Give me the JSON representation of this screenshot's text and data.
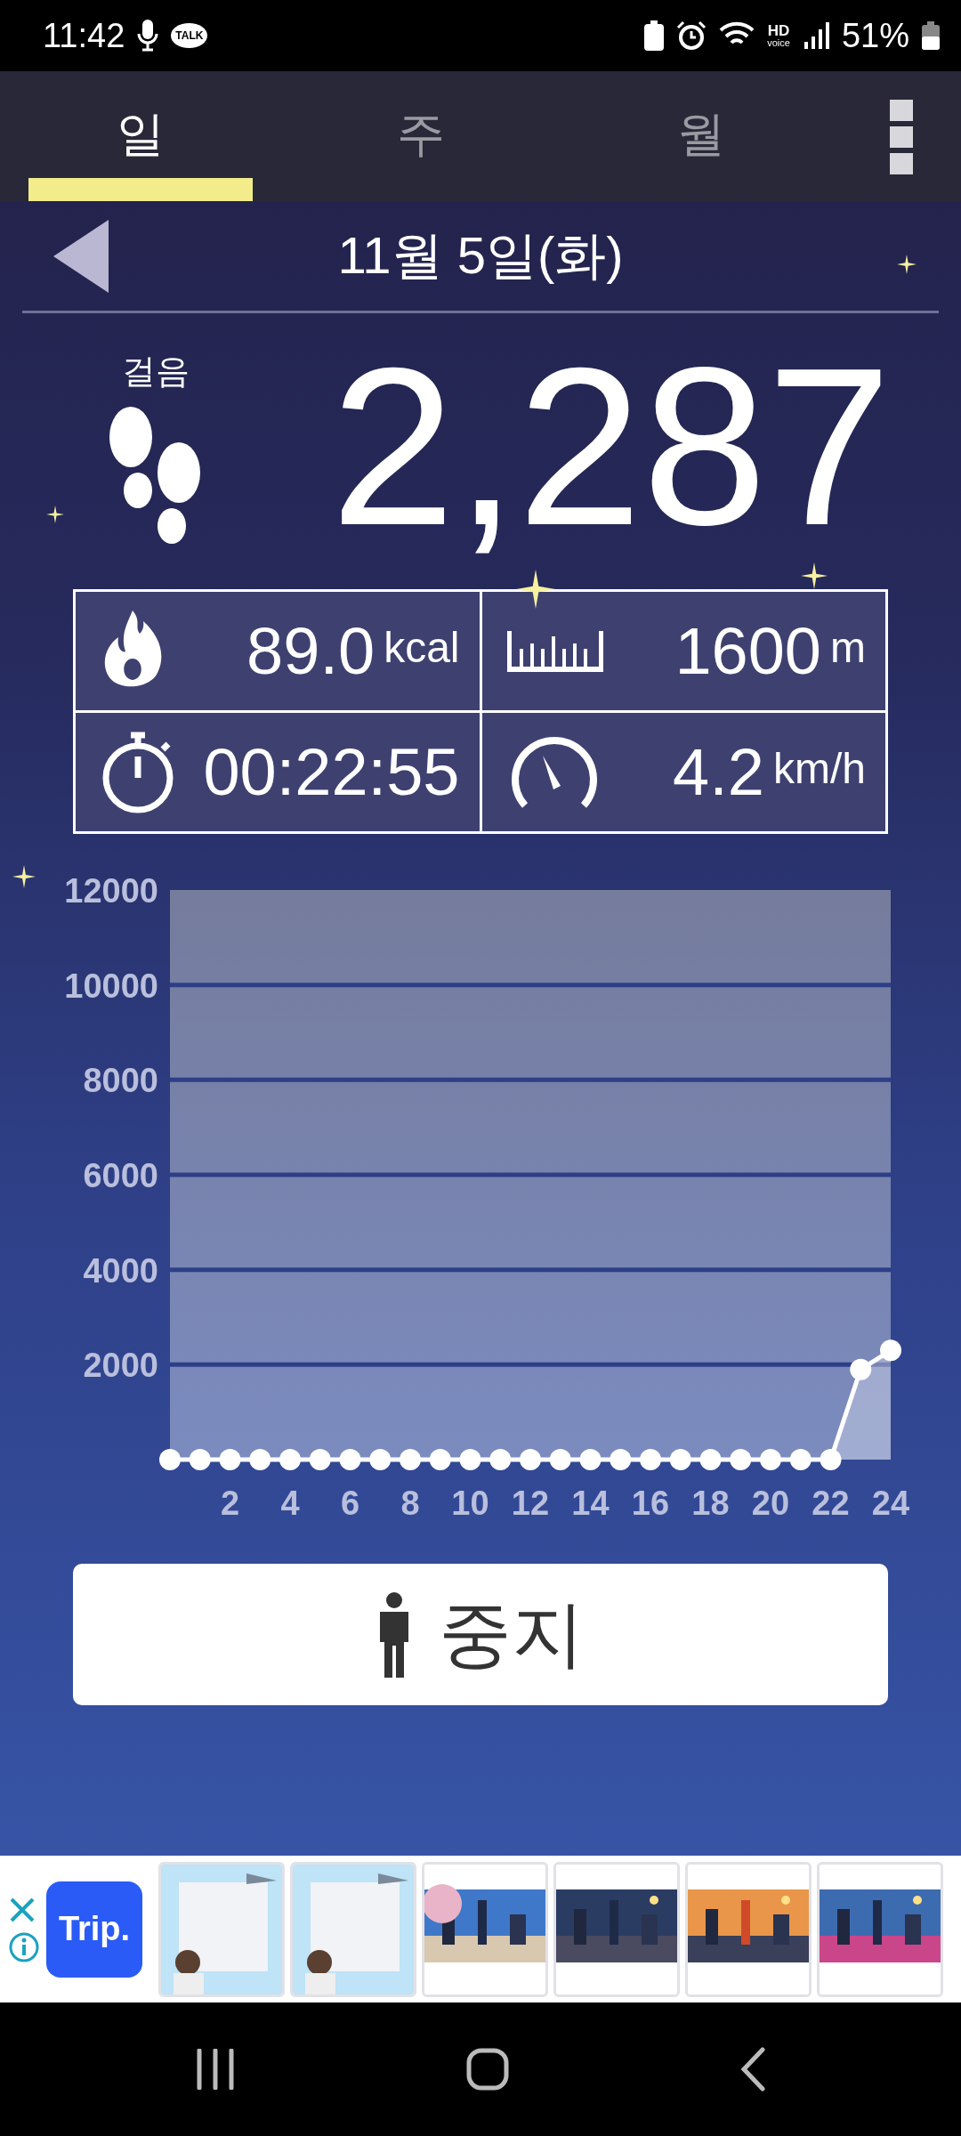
{
  "status_bar": {
    "time": "11:42",
    "talk_badge": "TALK",
    "hd_label": "HD",
    "voice_label": "voice",
    "battery": "51%"
  },
  "tabs": [
    {
      "label": "일",
      "selected": true
    },
    {
      "label": "주",
      "selected": false
    },
    {
      "label": "월",
      "selected": false
    }
  ],
  "date_header": {
    "date": "11월 5일(화)"
  },
  "steps": {
    "label": "걸음",
    "count": "2,287"
  },
  "stats": [
    {
      "kind": "calories",
      "value": "89.0",
      "unit": "kcal"
    },
    {
      "kind": "distance",
      "value": "1600",
      "unit": "m"
    },
    {
      "kind": "duration",
      "value": "00:22:55"
    },
    {
      "kind": "speed",
      "value": "4.2",
      "unit": "km/h"
    }
  ],
  "chart": {
    "chart_data": {
      "type": "area",
      "x": [
        0,
        1,
        2,
        3,
        4,
        5,
        6,
        7,
        8,
        9,
        10,
        11,
        12,
        13,
        14,
        15,
        16,
        17,
        18,
        19,
        20,
        21,
        22,
        23,
        24
      ],
      "grid": true,
      "xlim": [
        0,
        24
      ],
      "ylim": [
        0,
        12000
      ],
      "xticks": [
        2,
        4,
        6,
        8,
        10,
        12,
        14,
        16,
        18,
        20,
        22,
        24
      ],
      "yticks": [
        2000,
        4000,
        6000,
        8000,
        10000,
        12000
      ],
      "series": [
        {
          "color": "#ffffff",
          "values": [
            0,
            0,
            0,
            0,
            0,
            0,
            0,
            0,
            0,
            0,
            0,
            0,
            0,
            0,
            0,
            0,
            0,
            0,
            0,
            0,
            0,
            0,
            0,
            1900,
            2300
          ]
        }
      ]
    }
  },
  "stop_button": {
    "label": "중지"
  },
  "ad": {
    "logo": "Trip."
  }
}
